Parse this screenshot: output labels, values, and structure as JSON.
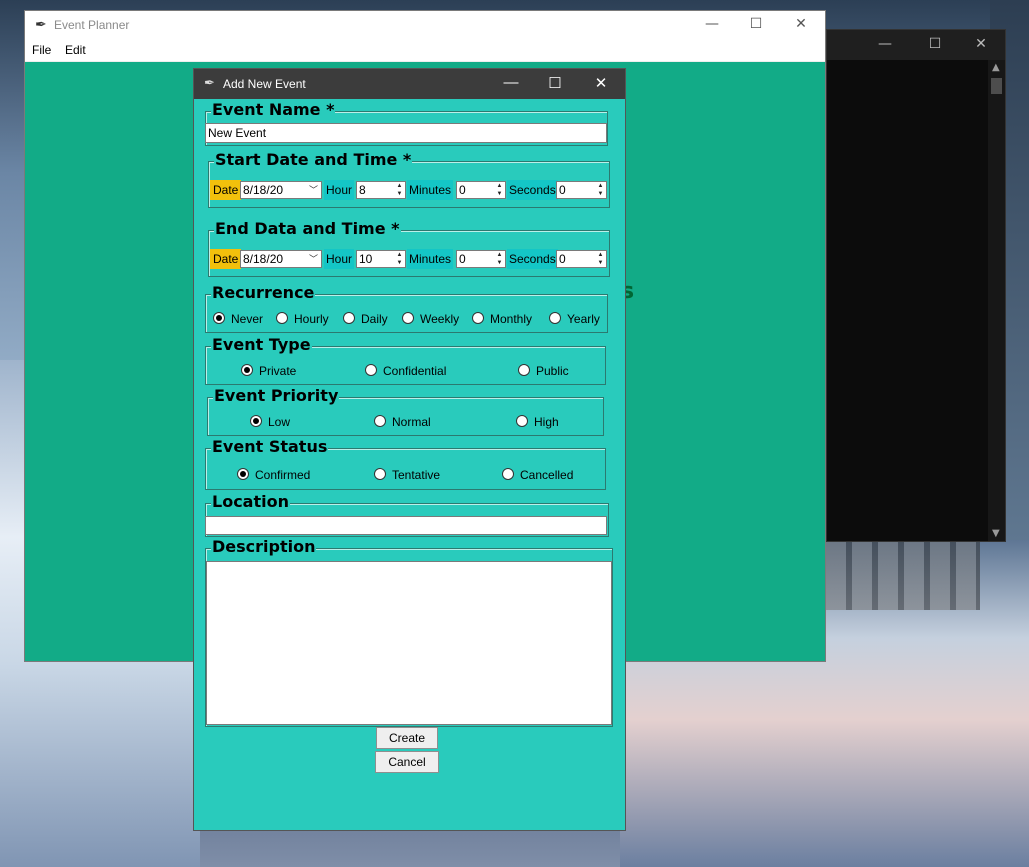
{
  "main_window": {
    "title": "Event Planner",
    "menu": [
      "File",
      "Edit"
    ],
    "bg_glyph": "s"
  },
  "dialog": {
    "title": "Add New Event",
    "event_name": {
      "label": "Event Name *",
      "value": "New Event"
    },
    "start": {
      "label": "Start Date and Time *",
      "date_label": "Date",
      "date_value": "8/18/20",
      "hour_label": "Hour",
      "hour_value": "8",
      "minutes_label": "Minutes",
      "minutes_value": "0",
      "seconds_label": "Seconds",
      "seconds_value": "0"
    },
    "end": {
      "label": "End Data and Time *",
      "date_label": "Date",
      "date_value": "8/18/20",
      "hour_label": "Hour",
      "hour_value": "10",
      "minutes_label": "Minutes",
      "minutes_value": "0",
      "seconds_label": "Seconds",
      "seconds_value": "0"
    },
    "recurrence": {
      "label": "Recurrence",
      "options": [
        "Never",
        "Hourly",
        "Daily",
        "Weekly",
        "Monthly",
        "Yearly"
      ],
      "selected": "Never"
    },
    "event_type": {
      "label": "Event Type",
      "options": [
        "Private",
        "Confidential",
        "Public"
      ],
      "selected": "Private"
    },
    "event_priority": {
      "label": "Event Priority",
      "options": [
        "Low",
        "Normal",
        "High"
      ],
      "selected": "Low"
    },
    "event_status": {
      "label": "Event Status",
      "options": [
        "Confirmed",
        "Tentative",
        "Cancelled"
      ],
      "selected": "Confirmed"
    },
    "location": {
      "label": "Location",
      "value": ""
    },
    "description": {
      "label": "Description",
      "value": ""
    },
    "buttons": {
      "create": "Create",
      "cancel": "Cancel"
    }
  },
  "window_controls": {
    "minimize": "—",
    "maximize": "☐",
    "close": "✕"
  },
  "colors": {
    "dialog_bg": "#29cbbc",
    "main_bg": "#12ab87",
    "date_label_bg": "#f2c00c",
    "time_label_bg": "#14c6c6"
  }
}
